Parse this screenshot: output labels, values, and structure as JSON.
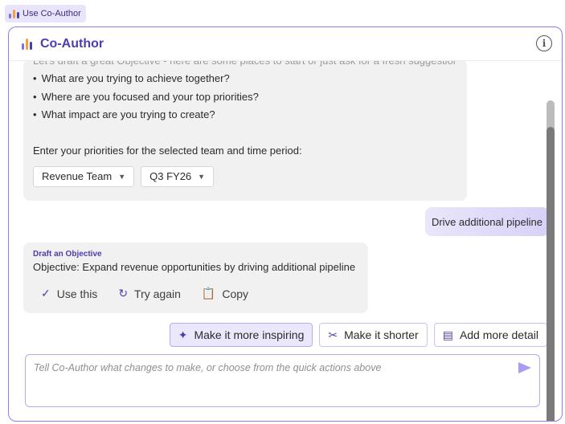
{
  "launcher": {
    "label": "Use Co-Author",
    "icon": "coauthor-logo-icon"
  },
  "header": {
    "title": "Co-Author",
    "info_icon": "info-icon"
  },
  "colors": {
    "accent": "#4b3fb0",
    "accent_light": "#ebe7fd",
    "border": "#8a7ff0",
    "bubble": "#f1f1f1"
  },
  "bot_message": {
    "cut_line": "Let's draft a great Objective - here are some places to start or just ask for a fresh suggestion.",
    "bullets": [
      "What are you trying to achieve together?",
      "Where are you focused and your top priorities?",
      "What impact are you trying to create?"
    ],
    "prompt": "Enter your priorities for the selected team and time period:",
    "team_select": "Revenue Team",
    "period_select": "Q3 FY26"
  },
  "user_message": "Drive additional pipeline",
  "draft": {
    "label": "Draft an Objective",
    "objective": "Objective: Expand revenue opportunities by driving additional pipeline",
    "actions": {
      "use": "Use this",
      "retry": "Try again",
      "copy": "Copy"
    }
  },
  "quick_actions": {
    "inspiring": "Make it more inspiring",
    "shorter": "Make it shorter",
    "detail": "Add more detail"
  },
  "composer": {
    "placeholder": "Tell Co-Author what changes to make, or choose from the quick actions above"
  }
}
